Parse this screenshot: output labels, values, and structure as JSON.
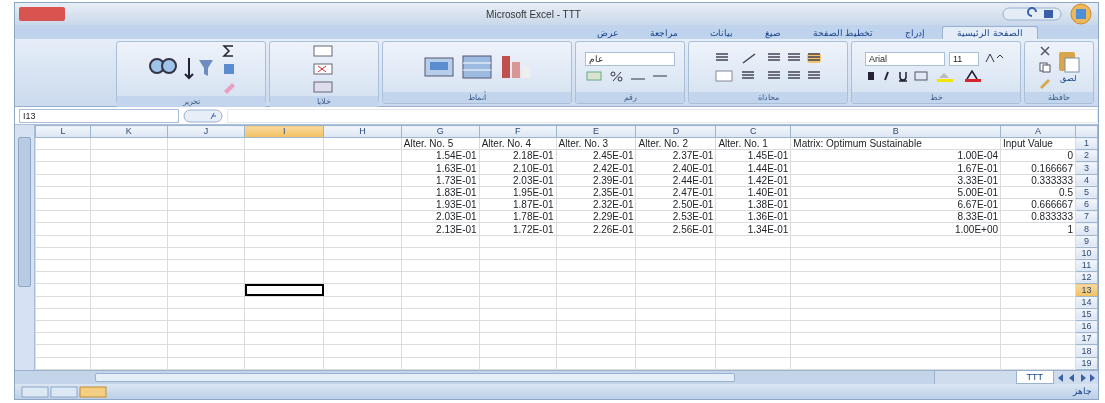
{
  "window": {
    "title": "Microsoft Excel - TTT"
  },
  "ribbon_tabs": [
    {
      "label": "الصفحة الرئيسية",
      "selected": true
    },
    {
      "label": "إدراج",
      "selected": false
    },
    {
      "label": "تخطيط الصفحة",
      "selected": false
    },
    {
      "label": "صيغ",
      "selected": false
    },
    {
      "label": "بيانات",
      "selected": false
    },
    {
      "label": "مراجعة",
      "selected": false
    },
    {
      "label": "عرض",
      "selected": false
    }
  ],
  "ribbon_groups": [
    {
      "label": "حافظة",
      "kind": "clipboard",
      "button": "لصق"
    },
    {
      "label": "خط",
      "kind": "font",
      "font": "Arial",
      "size": "11"
    },
    {
      "label": "محاذاة",
      "kind": "align"
    },
    {
      "label": "رقم",
      "kind": "number",
      "format": "عام"
    },
    {
      "label": "أنماط",
      "kind": "styles"
    },
    {
      "label": "خلايا",
      "kind": "cells"
    },
    {
      "label": "تحرير",
      "kind": "editing"
    }
  ],
  "name_box": "I13",
  "columns": [
    {
      "label": "L",
      "selected": false
    },
    {
      "label": "K",
      "selected": false
    },
    {
      "label": "J",
      "selected": false
    },
    {
      "label": "I",
      "selected": true
    },
    {
      "label": "H",
      "selected": false
    },
    {
      "label": "G",
      "selected": false
    },
    {
      "label": "F",
      "selected": false
    },
    {
      "label": "E",
      "selected": false
    },
    {
      "label": "D",
      "selected": false
    },
    {
      "label": "C",
      "selected": false
    },
    {
      "label": "B",
      "selected": false
    },
    {
      "label": "A",
      "selected": false
    }
  ],
  "rows": [
    {
      "label": "1",
      "selected": false,
      "cells": [
        "Alter. No. 5",
        "Alter. No. 4",
        "Alter. No. 3",
        "Alter. No. 2",
        "Alter. No. 1",
        "Matrix: Optimum Sustainable",
        "Input Value"
      ]
    },
    {
      "label": "2",
      "selected": false,
      "cells": [
        "1.54E-01",
        "2.18E-01",
        "2.45E-01",
        "2.37E-01",
        "1.45E-01",
        "1.00E-04",
        "0"
      ]
    },
    {
      "label": "3",
      "selected": false,
      "cells": [
        "1.63E-01",
        "2.10E-01",
        "2.42E-01",
        "2.40E-01",
        "1.44E-01",
        "1.67E-01",
        "0.166667"
      ]
    },
    {
      "label": "4",
      "selected": false,
      "cells": [
        "1.73E-01",
        "2.03E-01",
        "2.39E-01",
        "2.44E-01",
        "1.42E-01",
        "3.33E-01",
        "0.333333"
      ]
    },
    {
      "label": "5",
      "selected": false,
      "cells": [
        "1.83E-01",
        "1.95E-01",
        "2.35E-01",
        "2.47E-01",
        "1.40E-01",
        "5.00E-01",
        "0.5"
      ]
    },
    {
      "label": "6",
      "selected": false,
      "cells": [
        "1.93E-01",
        "1.87E-01",
        "2.32E-01",
        "2.50E-01",
        "1.38E-01",
        "6.67E-01",
        "0.666667"
      ]
    },
    {
      "label": "7",
      "selected": false,
      "cells": [
        "2.03E-01",
        "1.78E-01",
        "2.29E-01",
        "2.53E-01",
        "1.36E-01",
        "8.33E-01",
        "0.833333"
      ]
    },
    {
      "label": "8",
      "selected": false,
      "cells": [
        "2.13E-01",
        "1.72E-01",
        "2.26E-01",
        "2.56E-01",
        "1.34E-01",
        "1.00E+00",
        "1"
      ]
    },
    {
      "label": "9",
      "selected": false
    },
    {
      "label": "10",
      "selected": false
    },
    {
      "label": "11",
      "selected": false
    },
    {
      "label": "12",
      "selected": false
    },
    {
      "label": "13",
      "selected": true
    },
    {
      "label": "14",
      "selected": false
    },
    {
      "label": "15",
      "selected": false
    },
    {
      "label": "16",
      "selected": false
    },
    {
      "label": "17",
      "selected": false
    },
    {
      "label": "18",
      "selected": false
    },
    {
      "label": "19",
      "selected": false
    }
  ],
  "sheet_tabs": [
    {
      "label": "TTT",
      "selected": true
    }
  ],
  "status_bar": {
    "text": "جاهز"
  }
}
